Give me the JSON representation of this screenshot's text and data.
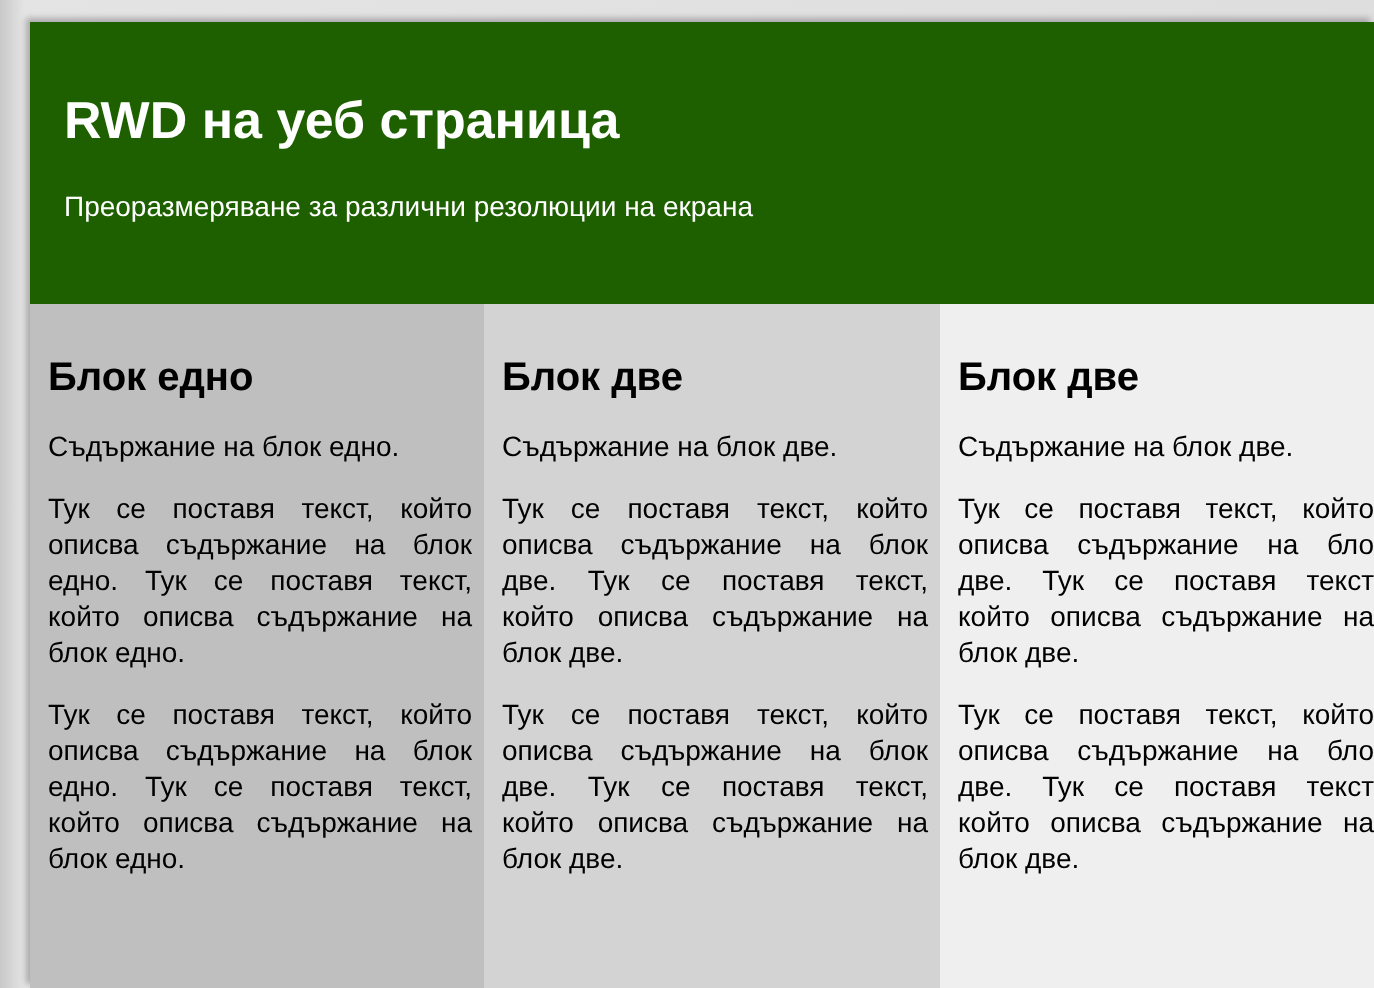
{
  "header": {
    "title": "RWD на уеб страница",
    "subtitle": "Преоразмеряване за различни резолюции на екрана"
  },
  "blocks": [
    {
      "heading": "Блок едно",
      "intro": "Съдържание на блок едно.",
      "paragraphs": [
        [
          "Тук се поставя текст, който",
          "описва съдържание на блок",
          "едно. Тук се поставя текст,",
          "който описва съдържание на",
          "блок едно."
        ],
        [
          "Тук се поставя текст, който",
          "описва съдържание на блок",
          "едно. Тук се поставя текст,",
          "който описва съдържание на",
          "блок едно."
        ]
      ]
    },
    {
      "heading": "Блок две",
      "intro": "Съдържание на блок две.",
      "paragraphs": [
        [
          "Тук се поставя текст, който",
          "описва съдържание на блок",
          "две. Тук се поставя текст,",
          "който описва съдържание на",
          "блок две."
        ],
        [
          "Тук се поставя текст, който",
          "описва съдържание на блок",
          "две. Тук се поставя текст,",
          "който описва съдържание на",
          "блок две."
        ]
      ]
    },
    {
      "heading": "Блок две",
      "intro": "Съдържание на блок две.",
      "paragraphs": [
        [
          "Тук се поставя текст, който",
          "описва съдържание на бло",
          "две. Тук се поставя текст",
          "който описва съдържание на",
          "блок две."
        ],
        [
          "Тук се поставя текст, който",
          "описва съдържание на бло",
          "две. Тук се поставя текст",
          "който описва съдържание на",
          "блок две."
        ]
      ]
    }
  ]
}
